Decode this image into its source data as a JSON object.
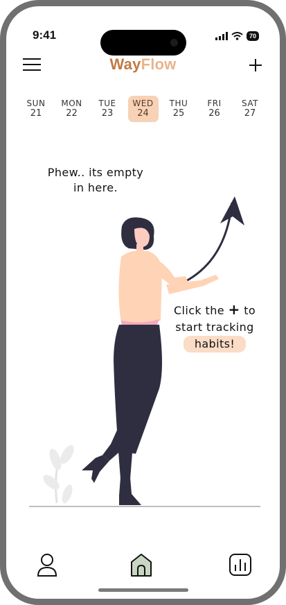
{
  "status": {
    "time": "9:41",
    "battery": "70"
  },
  "header": {
    "logo_part1": "Way",
    "logo_part2": "Flow"
  },
  "days": [
    {
      "name": "SUN",
      "date": "21"
    },
    {
      "name": "MON",
      "date": "22"
    },
    {
      "name": "TUE",
      "date": "23"
    },
    {
      "name": "WED",
      "date": "24"
    },
    {
      "name": "THU",
      "date": "25"
    },
    {
      "name": "FRI",
      "date": "26"
    },
    {
      "name": "SAT",
      "date": "27"
    }
  ],
  "selected_day": "WED",
  "empty": {
    "message_line1": "Phew.. its empty",
    "message_line2": "in here."
  },
  "hint": {
    "part1": "Click the",
    "plus": "+",
    "part2": "to",
    "line2": "start tracking",
    "line3": "habits!"
  },
  "colors": {
    "accent": "#c07a45",
    "accent_light": "#e7b48c",
    "highlight": "#f7d2b7",
    "tab_active": "#c9d6c3"
  },
  "tabs": [
    {
      "icon": "profile-icon",
      "active": false
    },
    {
      "icon": "home-icon",
      "active": true
    },
    {
      "icon": "stats-icon",
      "active": false
    }
  ]
}
